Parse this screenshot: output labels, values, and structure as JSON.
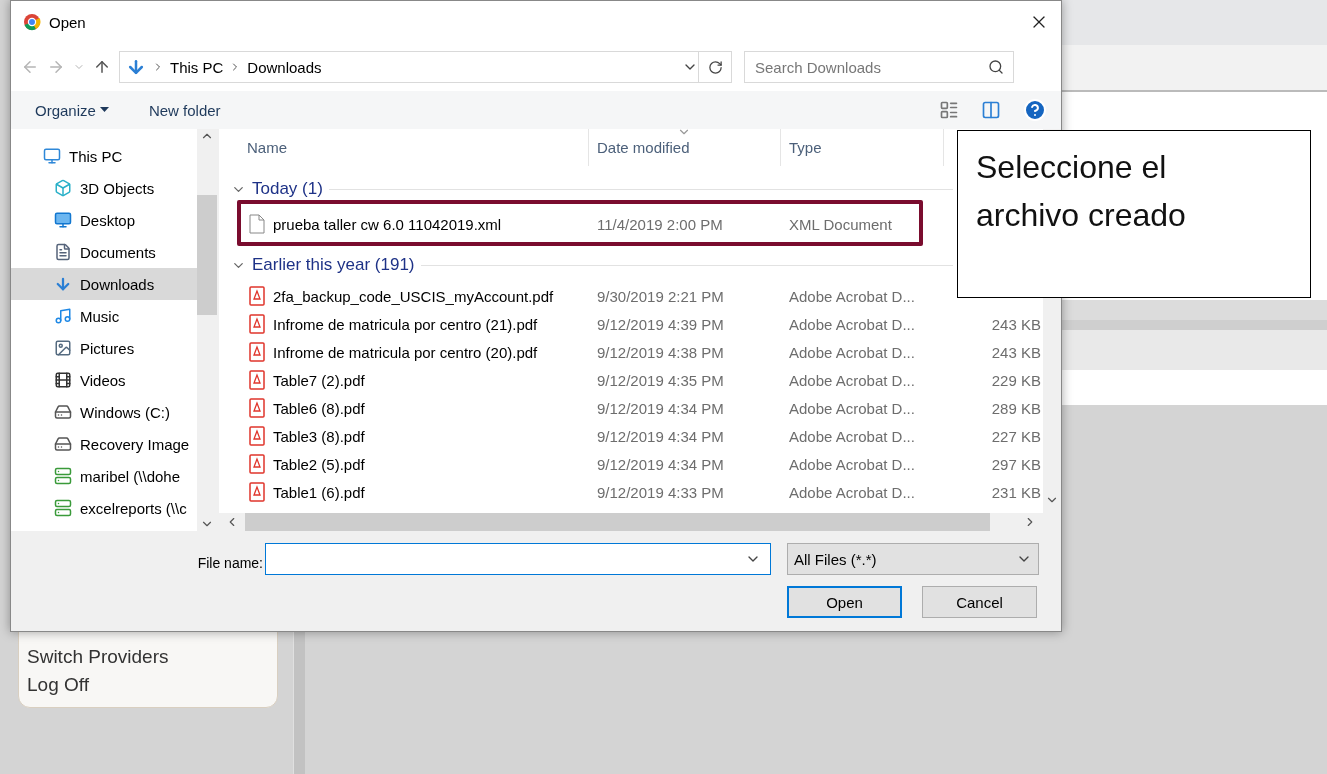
{
  "window": {
    "title": "Open"
  },
  "address": {
    "path": [
      "This PC",
      "Downloads"
    ]
  },
  "search": {
    "placeholder": "Search Downloads"
  },
  "toolbar": {
    "items": [
      "Organize",
      "New folder"
    ]
  },
  "nav_pane": {
    "items": [
      {
        "label": "This PC",
        "kind": "computer",
        "selected": false,
        "children": [
          {
            "label": "3D Objects",
            "kind": "objects",
            "selected": false
          },
          {
            "label": "Desktop",
            "kind": "desktop",
            "selected": false
          },
          {
            "label": "Documents",
            "kind": "documents",
            "selected": false
          },
          {
            "label": "Downloads",
            "kind": "downloads",
            "selected": true
          },
          {
            "label": "Music",
            "kind": "music",
            "selected": false
          },
          {
            "label": "Pictures",
            "kind": "pictures",
            "selected": false
          },
          {
            "label": "Videos",
            "kind": "videos",
            "selected": false
          },
          {
            "label": "Windows (C:)",
            "kind": "drive",
            "selected": false
          },
          {
            "label": "Recovery Image",
            "kind": "drive",
            "selected": false
          },
          {
            "label": "maribel (\\\\dohe",
            "kind": "network",
            "selected": false
          },
          {
            "label": "excelreports (\\\\c",
            "kind": "network",
            "selected": false
          }
        ]
      }
    ]
  },
  "file_list": {
    "columns": [
      {
        "label": "Name",
        "sorted": false
      },
      {
        "label": "Date modified",
        "sorted": true
      },
      {
        "label": "Type",
        "sorted": false
      }
    ],
    "groups": [
      {
        "label": "Today (1)",
        "expanded": true,
        "files": [
          {
            "name": "prueba taller cw 6.0 11042019.xml",
            "date": "11/4/2019 2:00 PM",
            "type": "XML Document",
            "kind": "xml",
            "outlined": true
          }
        ]
      },
      {
        "label": "Earlier this year (191)",
        "expanded": true,
        "files": [
          {
            "name": "2fa_backup_code_USCIS_myAccount.pdf",
            "date": "9/30/2019 2:21 PM",
            "type": "Adobe Acrobat D...",
            "kind": "pdf",
            "outlined": false
          },
          {
            "name": "Infrome de matricula por centro (21).pdf",
            "date": "9/12/2019 4:39 PM",
            "type": "Adobe Acrobat D...",
            "size": "243 KB",
            "kind": "pdf",
            "outlined": false
          },
          {
            "name": "Infrome de matricula por centro (20).pdf",
            "date": "9/12/2019 4:38 PM",
            "type": "Adobe Acrobat D...",
            "size": "243 KB",
            "kind": "pdf",
            "outlined": false
          },
          {
            "name": "Table7 (2).pdf",
            "date": "9/12/2019 4:35 PM",
            "type": "Adobe Acrobat D...",
            "size": "229 KB",
            "kind": "pdf",
            "outlined": false
          },
          {
            "name": "Table6 (8).pdf",
            "date": "9/12/2019 4:34 PM",
            "type": "Adobe Acrobat D...",
            "size": "289 KB",
            "kind": "pdf",
            "outlined": false
          },
          {
            "name": "Table3 (8).pdf",
            "date": "9/12/2019 4:34 PM",
            "type": "Adobe Acrobat D...",
            "size": "227 KB",
            "kind": "pdf",
            "outlined": false
          },
          {
            "name": "Table2 (5).pdf",
            "date": "9/12/2019 4:34 PM",
            "type": "Adobe Acrobat D...",
            "size": "297 KB",
            "kind": "pdf",
            "outlined": false
          },
          {
            "name": "Table1 (6).pdf",
            "date": "9/12/2019 4:33 PM",
            "type": "Adobe Acrobat D...",
            "size": "231 KB",
            "kind": "pdf",
            "outlined": false
          }
        ]
      }
    ]
  },
  "file_name": {
    "label": "File name:"
  },
  "file_type": {
    "value": "All Files (*.*)"
  },
  "buttons": [
    {
      "label": "Open",
      "default": true
    },
    {
      "label": "Cancel",
      "default": false
    }
  ],
  "callout": {
    "text": "Seleccione el archivo creado"
  },
  "background_menu": {
    "items": [
      "Switch Providers",
      "Log Off"
    ]
  }
}
